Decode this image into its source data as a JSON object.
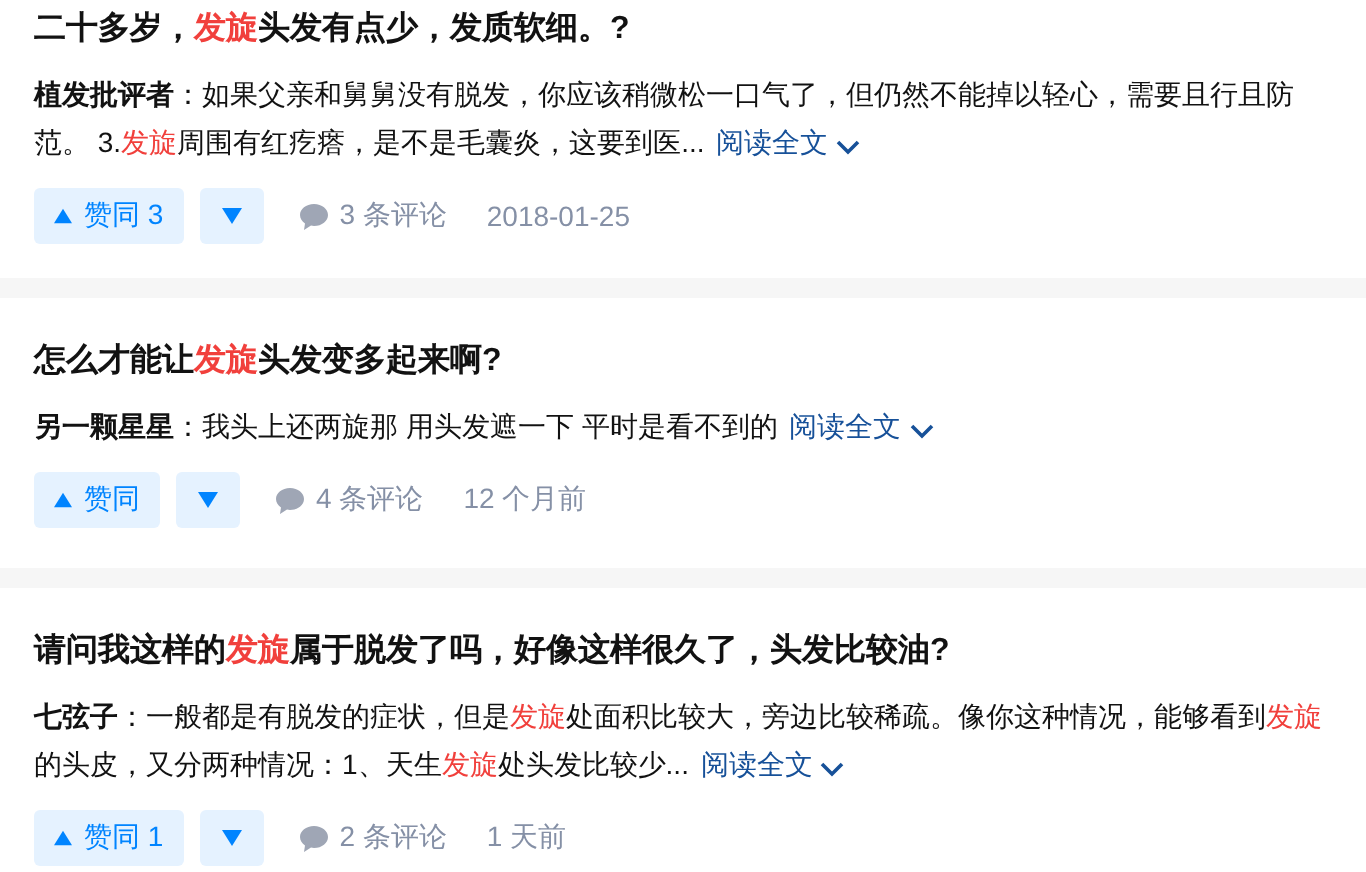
{
  "results": [
    {
      "title": [
        {
          "text": "二十多岁，",
          "highlight": false
        },
        {
          "text": "发旋",
          "highlight": true
        },
        {
          "text": "头发有点少，发质软细。?",
          "highlight": false
        }
      ],
      "author": "植发批评者",
      "excerpt": [
        {
          "text": "：如果父亲和舅舅没有脱发，你应该稍微松一口气了，但仍然不能掉以轻心，需要且行且防范。 3.",
          "highlight": false
        },
        {
          "text": "发旋",
          "highlight": true
        },
        {
          "text": "周围有红疙瘩，是不是毛囊炎，这要到医...",
          "highlight": false
        }
      ],
      "read_more": "阅读全文",
      "upvote": "赞同 3",
      "comments": "3 条评论",
      "time": "2018-01-25"
    },
    {
      "title": [
        {
          "text": "怎么才能让",
          "highlight": false
        },
        {
          "text": "发旋",
          "highlight": true
        },
        {
          "text": "头发变多起来啊?",
          "highlight": false
        }
      ],
      "author": "另一颗星星",
      "excerpt": [
        {
          "text": "：我头上还两旋那 用头发遮一下 平时是看不到的",
          "highlight": false
        }
      ],
      "read_more": "阅读全文",
      "upvote": "赞同",
      "comments": "4 条评论",
      "time": "12 个月前"
    },
    {
      "title": [
        {
          "text": "请问我这样的",
          "highlight": false
        },
        {
          "text": "发旋",
          "highlight": true
        },
        {
          "text": "属于脱发了吗，好像这样很久了，头发比较油?",
          "highlight": false
        }
      ],
      "author": "七弦子",
      "excerpt": [
        {
          "text": "：一般都是有脱发的症状，但是",
          "highlight": false
        },
        {
          "text": "发旋",
          "highlight": true
        },
        {
          "text": "处面积比较大，旁边比较稀疏。像你这种情况，能够看到",
          "highlight": false
        },
        {
          "text": "发旋",
          "highlight": true
        },
        {
          "text": "的头皮，又分两种情况：1、天生",
          "highlight": false
        },
        {
          "text": "发旋",
          "highlight": true
        },
        {
          "text": "处头发比较少...",
          "highlight": false
        }
      ],
      "read_more": "阅读全文",
      "upvote": "赞同 1",
      "comments": "2 条评论",
      "time": "1 天前"
    }
  ]
}
